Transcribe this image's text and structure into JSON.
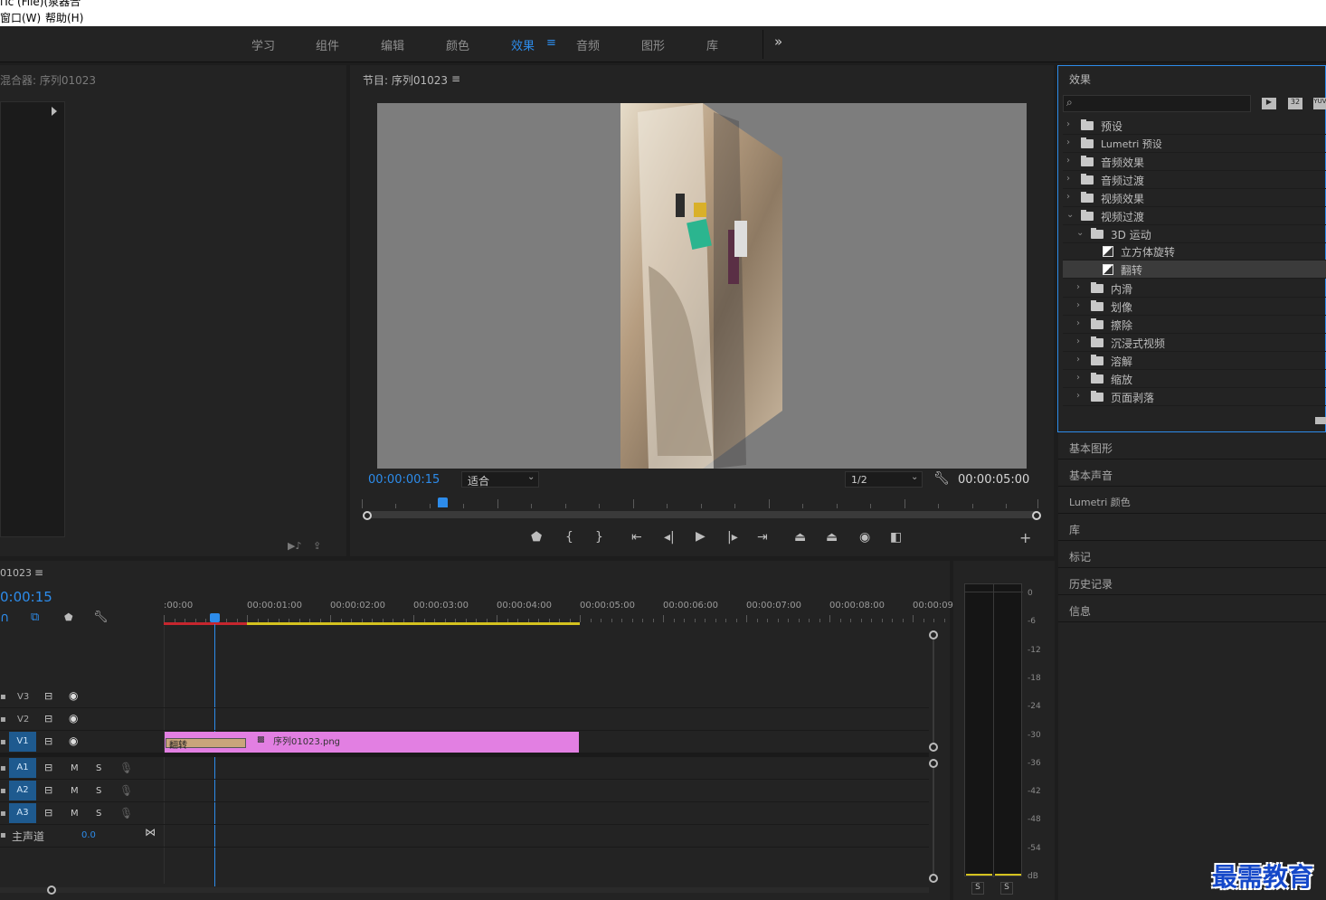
{
  "app": {
    "title": "iTc (File)(泉器合"
  },
  "menu": {
    "items": [
      "窗口(W)",
      "帮助(H)"
    ]
  },
  "workspaces": {
    "tabs": [
      {
        "label": "学习"
      },
      {
        "label": "组件"
      },
      {
        "label": "编辑"
      },
      {
        "label": "颜色"
      },
      {
        "label": "效果"
      },
      {
        "label": "音频"
      },
      {
        "label": "图形"
      },
      {
        "label": "库"
      }
    ],
    "active": "效果",
    "more": "»"
  },
  "mixer": {
    "title": "混合器: 序列01023"
  },
  "program": {
    "title": "节目: 序列01023",
    "timecode": "00:00:00:15",
    "fit": "适合",
    "resolution": "1/2",
    "duration": "00:00:05:00"
  },
  "effects": {
    "title": "效果",
    "search_placeholder": "",
    "badges": [
      "32",
      "YUV"
    ],
    "tree": [
      {
        "label": "预设",
        "level": 0,
        "type": "folder"
      },
      {
        "label": "Lumetri 预设",
        "level": 0,
        "type": "folder"
      },
      {
        "label": "音频效果",
        "level": 0,
        "type": "folder"
      },
      {
        "label": "音频过渡",
        "level": 0,
        "type": "folder"
      },
      {
        "label": "视频效果",
        "level": 0,
        "type": "folder"
      },
      {
        "label": "视频过渡",
        "level": 0,
        "type": "folder",
        "expanded": true
      },
      {
        "label": "3D 运动",
        "level": 1,
        "type": "folder",
        "expanded": true
      },
      {
        "label": "立方体旋转",
        "level": 2,
        "type": "effect"
      },
      {
        "label": "翻转",
        "level": 2,
        "type": "effect",
        "selected": true
      },
      {
        "label": "内滑",
        "level": 1,
        "type": "folder"
      },
      {
        "label": "划像",
        "level": 1,
        "type": "folder"
      },
      {
        "label": "擦除",
        "level": 1,
        "type": "folder"
      },
      {
        "label": "沉浸式视频",
        "level": 1,
        "type": "folder"
      },
      {
        "label": "溶解",
        "level": 1,
        "type": "folder"
      },
      {
        "label": "缩放",
        "level": 1,
        "type": "folder"
      },
      {
        "label": "页面剥落",
        "level": 1,
        "type": "folder"
      }
    ]
  },
  "side_panels": [
    "基本图形",
    "基本声音",
    "Lumetri 颜色",
    "库",
    "标记",
    "历史记录",
    "信息"
  ],
  "timeline": {
    "title": "01023",
    "timecode": "0:00:15",
    "ruler": [
      ":00:00",
      "00:00:01:00",
      "00:00:02:00",
      "00:00:03:00",
      "00:00:04:00",
      "00:00:05:00",
      "00:00:06:00",
      "00:00:07:00",
      "00:00:08:00",
      "00:00:09:"
    ],
    "video_tracks": [
      {
        "name": "V3"
      },
      {
        "name": "V2"
      },
      {
        "name": "V1",
        "target": true
      }
    ],
    "audio_tracks": [
      {
        "name": "A1",
        "m": "M",
        "s": "S"
      },
      {
        "name": "A2",
        "m": "M",
        "s": "S"
      },
      {
        "name": "A3",
        "m": "M",
        "s": "S"
      }
    ],
    "master": {
      "label": "主声道",
      "value": "0.0"
    },
    "clip": {
      "name": "序列01023.png",
      "transition": "翻转"
    }
  },
  "meter": {
    "scale": [
      "0",
      "-6",
      "-12",
      "-18",
      "-24",
      "-30",
      "-36",
      "-42",
      "-48",
      "-54",
      "dB"
    ],
    "solo": [
      "S",
      "S"
    ]
  },
  "watermark": "最需教育",
  "colors": {
    "accent": "#2d8ceb",
    "clip": "#e27fe2",
    "in_out": "#d4c21f",
    "unrendered": "#c6262e"
  }
}
